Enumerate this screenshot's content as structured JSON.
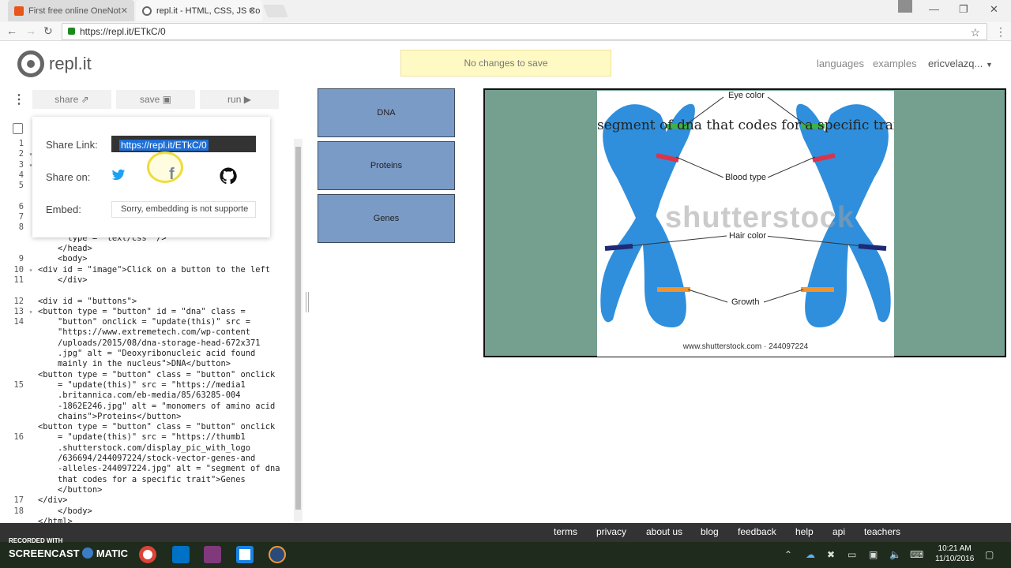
{
  "browser": {
    "tabs": [
      {
        "title": "First free online OneNot",
        "active": false,
        "icon": "office-icon",
        "color": "#e8561a"
      },
      {
        "title": "repl.it - HTML, CSS, JS Co",
        "active": true,
        "icon": "replit-icon",
        "color": "#666666"
      }
    ],
    "url": "https://repl.it/ETkC/0"
  },
  "header": {
    "logo_text": "repl.it",
    "notice": "No changes to save",
    "links": [
      "languages",
      "examples"
    ],
    "user": "ericvelazq..."
  },
  "toolbar": {
    "share": "share",
    "save": "save",
    "run": "run"
  },
  "share_popup": {
    "share_link_label": "Share Link:",
    "share_link_value": "https://repl.it/ETkC/0",
    "share_on_label": "Share on:",
    "embed_label": "Embed:",
    "embed_value": "Sorry, embedding is not supporte"
  },
  "code": {
    "lines": [
      {
        "n": "1",
        "t": "",
        "f": ""
      },
      {
        "n": "2",
        "t": "",
        "f": "▾"
      },
      {
        "n": "3",
        "t": "",
        "f": "▾"
      },
      {
        "n": "4",
        "t": "",
        "f": ""
      },
      {
        "n": "5",
        "t": "",
        "f": ""
      },
      {
        "n": "",
        "t": "",
        "f": ""
      },
      {
        "n": "6",
        "t": "",
        "f": ""
      },
      {
        "n": "7",
        "t": "",
        "f": ""
      },
      {
        "n": "8",
        "t": "                                         \"",
        "f": ""
      },
      {
        "n": "",
        "t": "      type = \"text/css\" />",
        "f": ""
      },
      {
        "n": "",
        "t": "    </head>",
        "f": ""
      },
      {
        "n": "9",
        "t": "    <body>",
        "f": ""
      },
      {
        "n": "10",
        "t": "<div id = \"image\">Click on a button to the left",
        "f": "▾"
      },
      {
        "n": "11",
        "t": "    </div>",
        "f": ""
      },
      {
        "n": "",
        "t": "",
        "f": ""
      },
      {
        "n": "12",
        "t": "<div id = \"buttons\">",
        "f": ""
      },
      {
        "n": "13",
        "t": "<button type = \"button\" id = \"dna\" class =",
        "f": "▾"
      },
      {
        "n": "14",
        "t": "    \"button\" onclick = \"update(this)\" src =",
        "f": ""
      },
      {
        "n": "",
        "t": "    \"https://www.extremetech.com/wp-content",
        "f": ""
      },
      {
        "n": "",
        "t": "    /uploads/2015/08/dna-storage-head-672x371",
        "f": ""
      },
      {
        "n": "",
        "t": "    .jpg\" alt = \"Deoxyribonucleic acid found",
        "f": ""
      },
      {
        "n": "",
        "t": "    mainly in the nucleus\">DNA</button>",
        "f": ""
      },
      {
        "n": "",
        "t": "<button type = \"button\" class = \"button\" onclick",
        "f": ""
      },
      {
        "n": "15",
        "t": "    = \"update(this)\" src = \"https://media1",
        "f": ""
      },
      {
        "n": "",
        "t": "    .britannica.com/eb-media/85/63285-004",
        "f": ""
      },
      {
        "n": "",
        "t": "    -1862E246.jpg\" alt = \"monomers of amino acid",
        "f": ""
      },
      {
        "n": "",
        "t": "    chains\">Proteins</button>",
        "f": ""
      },
      {
        "n": "",
        "t": "<button type = \"button\" class = \"button\" onclick",
        "f": ""
      },
      {
        "n": "16",
        "t": "    = \"update(this)\" src = \"https://thumb1",
        "f": ""
      },
      {
        "n": "",
        "t": "    .shutterstock.com/display_pic_with_logo",
        "f": ""
      },
      {
        "n": "",
        "t": "    /636694/244097224/stock-vector-genes-and",
        "f": ""
      },
      {
        "n": "",
        "t": "    -alleles-244097224.jpg\" alt = \"segment of dna",
        "f": ""
      },
      {
        "n": "",
        "t": "    that codes for a specific trait\">Genes",
        "f": ""
      },
      {
        "n": "",
        "t": "    </button>",
        "f": ""
      },
      {
        "n": "17",
        "t": "</div>",
        "f": ""
      },
      {
        "n": "18",
        "t": "    </body>",
        "f": ""
      },
      {
        "n": "",
        "t": "</html>",
        "f": ""
      }
    ]
  },
  "output": {
    "buttons": [
      "DNA",
      "Proteins",
      "Genes"
    ],
    "image_caption": "segment of dna that codes for a specific trait",
    "labels": [
      "Eye color",
      "Blood type",
      "Hair color",
      "Growth"
    ],
    "watermark": "shutterstock",
    "credit": "www.shutterstock.com · 244097224"
  },
  "footer": {
    "links": [
      "terms",
      "privacy",
      "about us",
      "blog",
      "feedback",
      "help",
      "api",
      "teachers"
    ]
  },
  "taskbar": {
    "rec_line1": "RECORDED WITH",
    "rec_line2": "SCREENCAST",
    "rec_line3": "MATIC",
    "time": "10:21 AM",
    "date": "11/10/2016"
  }
}
